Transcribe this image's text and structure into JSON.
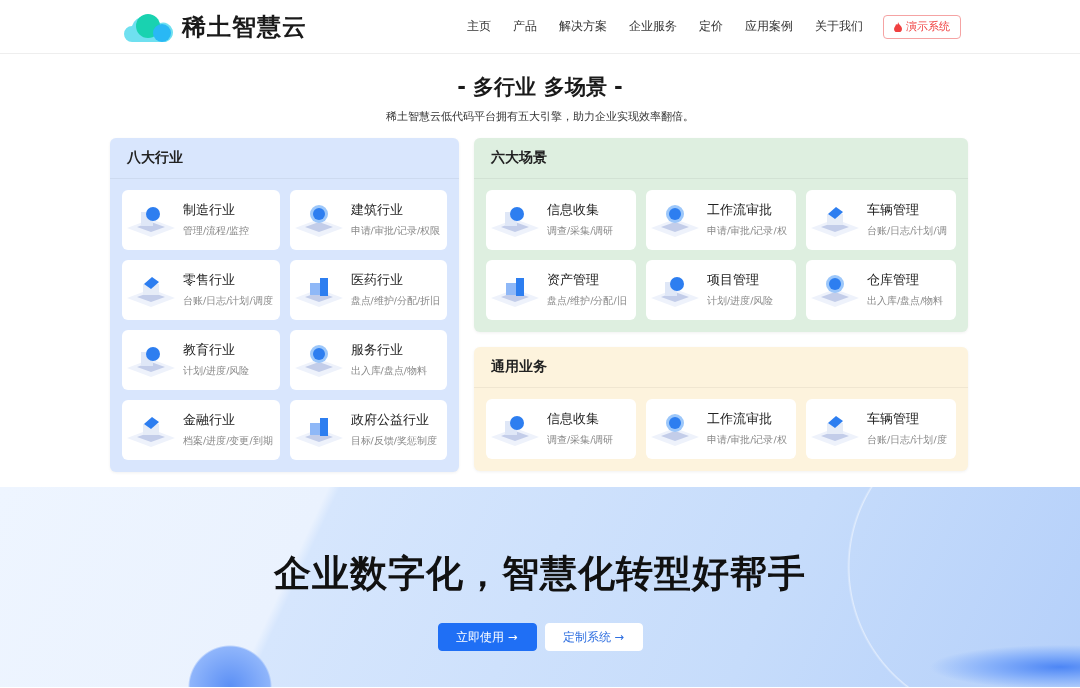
{
  "header": {
    "logo": "稀土智慧云",
    "nav": [
      "主页",
      "产品",
      "解决方案",
      "企业服务",
      "定价",
      "应用案例",
      "关于我们"
    ],
    "demo_button": "演示系统"
  },
  "section": {
    "title": "- 多行业 多场景 -",
    "subtitle": "稀土智慧云低代码平台拥有五大引擎，助力企业实现效率翻倍。"
  },
  "industries": {
    "title": "八大行业",
    "items": [
      {
        "title": "制造行业",
        "subtitle": "管理/流程/监控"
      },
      {
        "title": "建筑行业",
        "subtitle": "申请/审批/记录/权限"
      },
      {
        "title": "零售行业",
        "subtitle": "台账/日志/计划/调度"
      },
      {
        "title": "医药行业",
        "subtitle": "盘点/维护/分配/折旧"
      },
      {
        "title": "教育行业",
        "subtitle": "计划/进度/风险"
      },
      {
        "title": "服务行业",
        "subtitle": "出入库/盘点/物料"
      },
      {
        "title": "金融行业",
        "subtitle": "档案/进度/变更/到期"
      },
      {
        "title": "政府公益行业",
        "subtitle": "目标/反馈/奖惩制度"
      }
    ]
  },
  "scenarios": {
    "title": "六大场景",
    "items": [
      {
        "title": "信息收集",
        "subtitle": "调查/采集/调研"
      },
      {
        "title": "工作流审批",
        "subtitle": "申请/审批/记录/权"
      },
      {
        "title": "车辆管理",
        "subtitle": "台账/日志/计划/调"
      },
      {
        "title": "资产管理",
        "subtitle": "盘点/维护/分配/旧"
      },
      {
        "title": "项目管理",
        "subtitle": "计划/进度/风险"
      },
      {
        "title": "仓库管理",
        "subtitle": "出入库/盘点/物料"
      }
    ]
  },
  "common": {
    "title": "通用业务",
    "items": [
      {
        "title": "信息收集",
        "subtitle": "调查/采集/调研"
      },
      {
        "title": "工作流审批",
        "subtitle": "申请/审批/记录/权"
      },
      {
        "title": "车辆管理",
        "subtitle": "台账/日志/计划/度"
      }
    ]
  },
  "hero": {
    "headline": "企业数字化，智慧化转型好帮手",
    "primary_button": "立即使用 →",
    "secondary_button": "定制系统 →"
  }
}
